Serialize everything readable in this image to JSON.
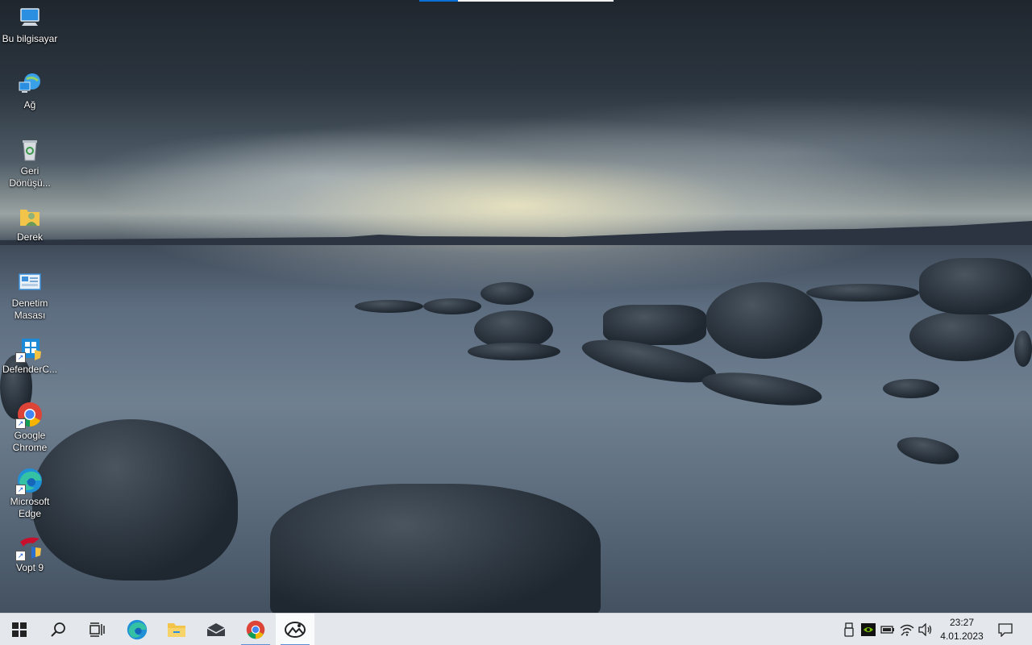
{
  "desktop": {
    "icons": [
      {
        "label": "Bu bilgisayar",
        "icon": "this-pc-icon"
      },
      {
        "label": "Ağ",
        "icon": "network-icon"
      },
      {
        "label": "Geri\nDönüşü...",
        "icon": "recycle-bin-icon"
      },
      {
        "label": "Derek",
        "icon": "user-folder-icon"
      },
      {
        "label": "Denetim\nMasası",
        "icon": "control-panel-icon"
      },
      {
        "label": "DefenderC...",
        "icon": "defender-control-icon"
      },
      {
        "label": "Google\nChrome",
        "icon": "chrome-icon"
      },
      {
        "label": "Microsoft\nEdge",
        "icon": "edge-icon"
      },
      {
        "label": "Vopt 9",
        "icon": "vopt-icon"
      }
    ]
  },
  "taskbar": {
    "buttons": [
      {
        "name": "start-button",
        "icon": "windows-logo-icon"
      },
      {
        "name": "search-button",
        "icon": "search-icon"
      },
      {
        "name": "task-view-button",
        "icon": "task-view-icon"
      },
      {
        "name": "edge-taskbar-button",
        "icon": "edge-icon"
      },
      {
        "name": "file-explorer-button",
        "icon": "folder-icon"
      },
      {
        "name": "mail-button",
        "icon": "mail-icon"
      },
      {
        "name": "chrome-taskbar-button",
        "icon": "chrome-icon"
      },
      {
        "name": "photos-button",
        "icon": "photos-icon"
      }
    ],
    "tray": {
      "time": "23:27",
      "date": "4.01.2023",
      "icons": [
        "usb-icon",
        "nvidia-icon",
        "battery-icon",
        "wifi-icon",
        "volume-icon",
        "notification-icon"
      ]
    }
  },
  "colors": {
    "taskbar_bg": "#e4e8ed",
    "accent": "#0a6fd6"
  }
}
